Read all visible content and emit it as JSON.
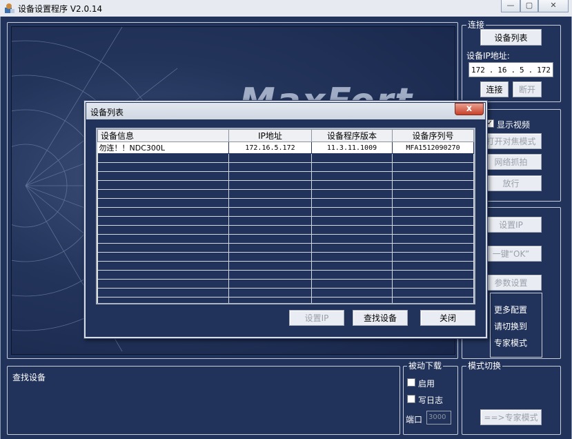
{
  "window": {
    "title": "设备设置程序 V2.0.14"
  },
  "connect": {
    "group_title": "连接",
    "device_list_button": "设备列表",
    "ip_label": "设备IP地址:",
    "ip": [
      "172",
      "16",
      "5",
      "172"
    ],
    "connect_button": "连接",
    "disconnect_button": "断开"
  },
  "video_ctrl": {
    "show_video": "显示视频",
    "open_focus": "打开对焦模式",
    "net_capture": "网络抓拍",
    "release": "放行"
  },
  "config": {
    "set_ip": "设置IP",
    "one_key_ok": "一键“OK”",
    "params": "参数设置",
    "more_config": [
      "更多配置",
      "请切换到",
      "专家模式"
    ]
  },
  "video": {
    "watermark": "MaxFort"
  },
  "log": {
    "text": "查找设备"
  },
  "passive_download": {
    "group_title": "被动下载",
    "enable": "启用",
    "write_log": "写日志",
    "port_label": "端口",
    "port_value": "3000"
  },
  "mode_switch": {
    "group_title": "模式切换",
    "expert_button": "==>专家模式"
  },
  "dialog": {
    "title": "设备列表",
    "close": "x",
    "columns": [
      "设备信息",
      "IP地址",
      "设备程序版本",
      "设备序列号"
    ],
    "rows": [
      [
        "勿连！！NDC300L",
        "172.16.5.172",
        "11.3.11.1009",
        "MFA1512090270"
      ]
    ],
    "set_ip_button": "设置IP",
    "find_button": "查找设备",
    "close_button": "关闭"
  },
  "colors": {
    "background": "#22335b",
    "border": "#c9cfdb"
  }
}
